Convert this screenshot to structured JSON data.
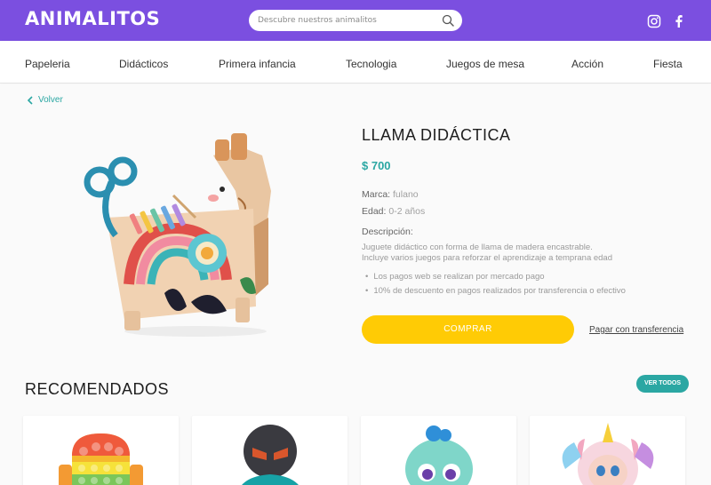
{
  "header": {
    "logo": "ANIMALITOS",
    "search": {
      "placeholder": "Descubre nuestros animalitos",
      "value": ""
    },
    "social": [
      "instagram-icon",
      "facebook-icon"
    ],
    "colors": {
      "bar": "#7b4fe0"
    }
  },
  "nav": {
    "items": [
      "Papeleria",
      "Didácticos",
      "Primera infancia",
      "Tecnologia",
      "Juegos de mesa",
      "Acción",
      "Fiesta"
    ]
  },
  "product": {
    "back_label": "Volver",
    "title": "LLAMA DIDÁCTICA",
    "price": "$ 700",
    "brand_label": "Marca:",
    "brand_value": "fulano",
    "age_label": "Edad:",
    "age_value": "0-2 años",
    "description_label": "Descripción:",
    "description_lines": [
      "Juguete didáctico con forma de llama de madera encastrable.",
      "Incluye varios juegos para reforzar el aprendizaje a temprana edad"
    ],
    "bullets": [
      "Los pagos web se realizan por mercado pago",
      "10% de descuento en pagos realizados por transferencia o efectivo"
    ],
    "buy_label": "COMPRAR",
    "transfer_label": "Pagar con transferencia",
    "colors": {
      "accent": "#2ba7a3",
      "buy": "#ffcb05"
    }
  },
  "recommended": {
    "title": "RECOMENDADOS",
    "see_all_label": "VER TODOS",
    "cards": [
      "pop-it-toy",
      "ninja-plush",
      "blue-plush",
      "unicorn-doll"
    ]
  }
}
